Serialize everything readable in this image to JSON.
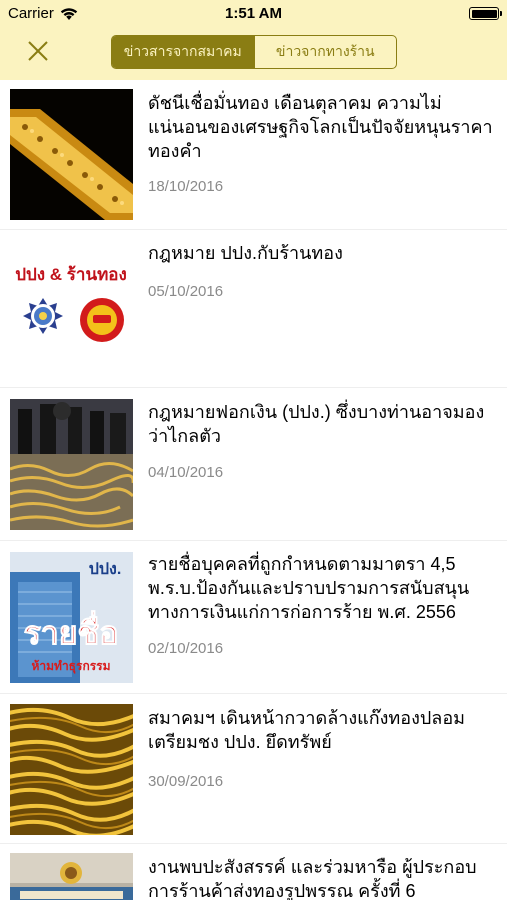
{
  "status_bar": {
    "carrier": "Carrier",
    "time": "1:51 AM"
  },
  "nav": {
    "close_icon": "close-x-icon",
    "tabs": [
      {
        "label": "ข่าวสารจากสมาคม",
        "selected": true
      },
      {
        "label": "ข่าวจากทางร้าน",
        "selected": false
      }
    ]
  },
  "news": [
    {
      "title": "ดัชนีเชื่อมั่นทอง เดือนตุลาคม ความไม่แน่นอนของเศรษฐกิจโลกเป็นปัจจัยหนุนราคาทองคำ",
      "date": "18/10/2016"
    },
    {
      "title": "กฎหมาย ปปง.กับร้านทอง",
      "date": "05/10/2016",
      "thumb_text": "ปปง & ร้านทอง"
    },
    {
      "title": "กฎหมายฟอกเงิน (ปปง.) ซึ่งบางท่านอาจมองว่าไกลตัว",
      "date": "04/10/2016"
    },
    {
      "title": "รายชื่อบุคคลที่ถูกกำหนดตามมาตรา 4,5 พ.ร.บ.ป้องกันและปราบปรามการสนับสนุนทางการเงินแก่การก่อการร้าย พ.ศ. 2556",
      "date": "02/10/2016",
      "thumb_text": "ปปง.",
      "thumb_text2": "รายชื่อ",
      "thumb_text3": "ห้ามทำธุรกรรม"
    },
    {
      "title": "สมาคมฯ เดินหน้ากวาดล้างแก๊งทองปลอม เตรียมชง ปปง. ยึดทรัพย์",
      "date": "30/09/2016"
    },
    {
      "title": "งานพบปะสังสรรค์ และร่วมหารือ ผู้ประกอบการร้านค้าส่งทองรูปพรรณ ครั้งที่ 6",
      "date": ""
    }
  ],
  "colors": {
    "header_bg": "#fbf3c0",
    "accent": "#8a7d13",
    "date_text": "#8a8a8a"
  }
}
